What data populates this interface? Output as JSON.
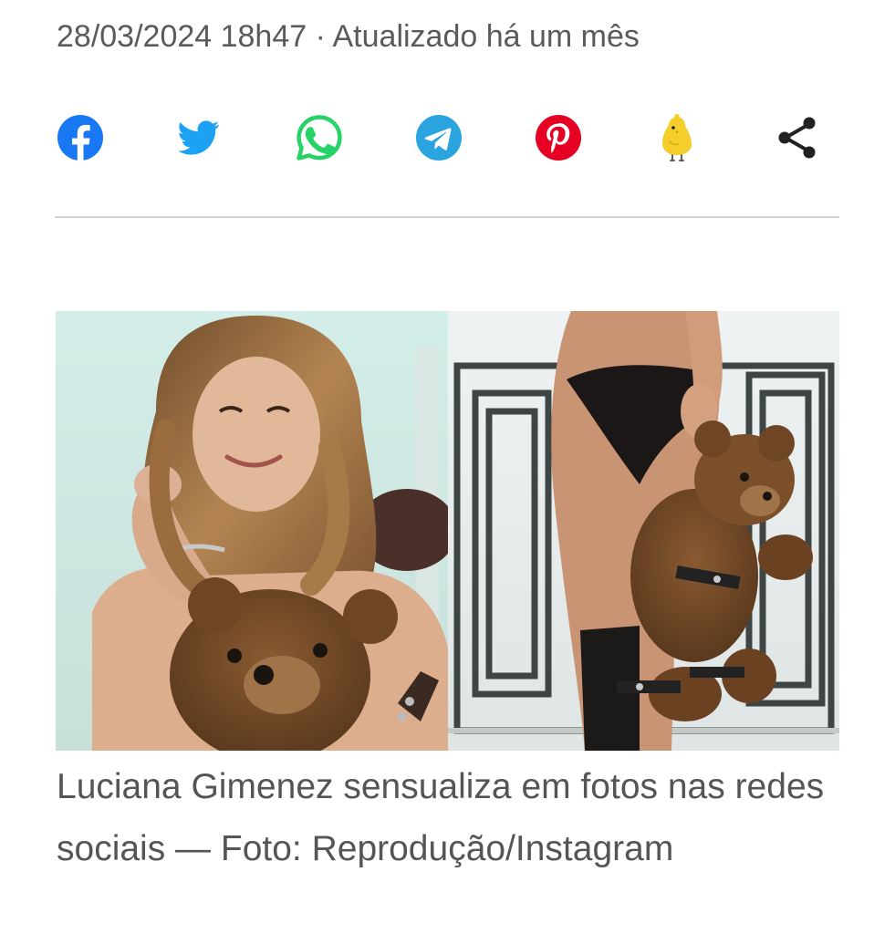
{
  "article": {
    "meta": "28/03/2024 18h47 · Atualizado há um mês"
  },
  "share": {
    "buttons": [
      {
        "name": "facebook",
        "icon": "facebook-icon",
        "color": "#1877f2"
      },
      {
        "name": "twitter",
        "icon": "twitter-bird-icon",
        "color": "#1da1f2"
      },
      {
        "name": "whatsapp",
        "icon": "whatsapp-icon",
        "color": "#25d366"
      },
      {
        "name": "telegram",
        "icon": "telegram-icon",
        "color": "#2aa3df"
      },
      {
        "name": "pinterest",
        "icon": "pinterest-icon",
        "color": "#e60023"
      },
      {
        "name": "koo",
        "icon": "koo-bird-icon",
        "color": "#f6ce2c"
      },
      {
        "name": "share",
        "icon": "share-icon",
        "color": "#222222"
      }
    ]
  },
  "photo": {
    "alt": "Luciana Gimenez sensualiza em fotos nas redes sociais",
    "caption": "Luciana Gimenez sensualiza em fotos nas redes sociais — Foto: Reprodução/Instagram"
  }
}
